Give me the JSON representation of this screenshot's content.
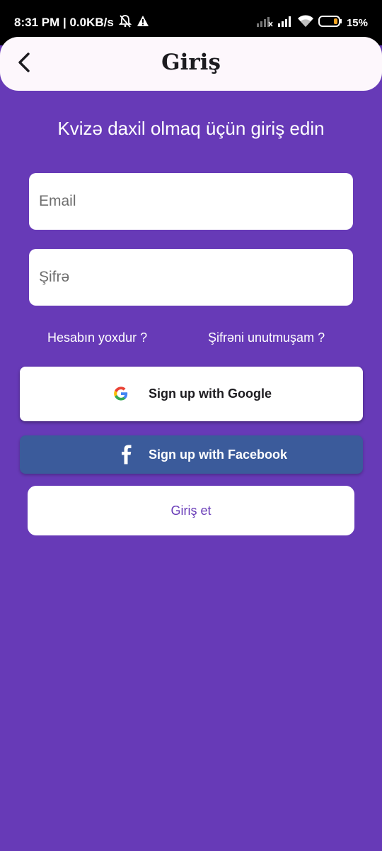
{
  "status_bar": {
    "time_network": "8:31 PM | 0.0KB/s",
    "battery": "15%",
    "icons": [
      "bell-off-icon",
      "alert-icon",
      "signal-weak-icon",
      "signal-icon",
      "wifi-icon",
      "battery-icon"
    ]
  },
  "appbar": {
    "title": "Giriş",
    "back_icon": "chevron-left-icon"
  },
  "subtitle": "Kvizə daxil olmaq üçün giriş edin",
  "form": {
    "email_placeholder": "Email",
    "email_value": "",
    "password_placeholder": "Şifrə",
    "password_value": ""
  },
  "links": {
    "no_account": "Hesabın yoxdur ?",
    "forgot_password": "Şifrəni unutmuşam ?"
  },
  "buttons": {
    "google_label": "Sign up with Google",
    "facebook_label": "Sign up with Facebook",
    "login_label": "Giriş et"
  },
  "colors": {
    "background": "#673ab7",
    "appbar": "#fdf7fc",
    "facebook": "#3b5b9b",
    "accent_text": "#673ab7"
  }
}
